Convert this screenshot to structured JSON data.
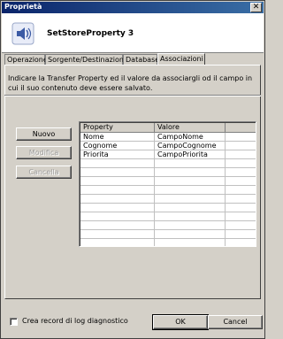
{
  "window": {
    "title": "Proprietà",
    "close_glyph": "✕"
  },
  "header": {
    "name": "SetStoreProperty 3",
    "icon": "speaker-icon"
  },
  "tabs": [
    {
      "label": "Operazione"
    },
    {
      "label": "Sorgente/Destinazione"
    },
    {
      "label": "Database"
    },
    {
      "label": "Associazioni"
    }
  ],
  "description": "Indicare la Transfer Property ed il valore da associargli od il campo in cui il suo contenuto deve essere salvato.",
  "buttons": {
    "new": "Nuovo",
    "edit": "Modifica",
    "delete": "Cancella"
  },
  "grid": {
    "columns": [
      "Property",
      "Valore"
    ],
    "rows": [
      [
        "Nome",
        "CampoNome"
      ],
      [
        "Cognome",
        "CampoCognome"
      ],
      [
        "Priorita",
        "CampoPriorita"
      ]
    ]
  },
  "footer": {
    "checkbox_label": "Crea record di log diagnostico",
    "ok": "OK",
    "cancel": "Cancel"
  }
}
